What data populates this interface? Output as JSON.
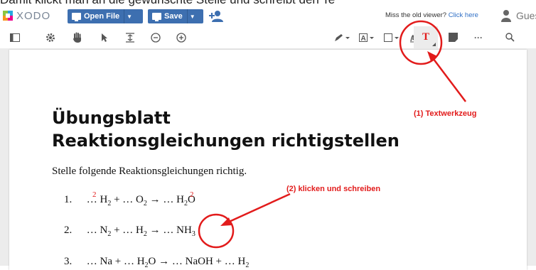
{
  "caption": "Damit klickt man an die gewünschte Stelle und schreibt den Te",
  "app": {
    "name": "XODO"
  },
  "topbar": {
    "open_file": "Open File",
    "save": "Save",
    "miss_text": "Miss the old viewer?",
    "click_here": "Click here",
    "user": "Guest"
  },
  "toolbar": {
    "icons": [
      "sidebar-icon",
      "gear-icon",
      "hand-icon",
      "pointer-icon",
      "fit-width-icon",
      "zoom-out-icon",
      "zoom-in-icon",
      "pen-icon",
      "text-style-icon",
      "shape-icon",
      "signature-icon",
      "text-tool-icon",
      "note-icon",
      "more-icon",
      "search-icon"
    ],
    "text_tool_glyph": "T",
    "more_glyph": "···"
  },
  "document": {
    "title_line1": "Übungsblatt",
    "title_line2": "Reaktionsgleichungen richtigstellen",
    "instruction": "Stelle folgende Reaktionsgleichungen richtig.",
    "equations": [
      {
        "num": "1.",
        "parts": [
          "… H",
          "2",
          " + … O",
          "2",
          " → … H",
          "2",
          "O"
        ]
      },
      {
        "num": "2.",
        "parts": [
          "… N",
          "2",
          " + … H",
          "2",
          " → … NH",
          "3",
          ""
        ]
      },
      {
        "num": "3.",
        "parts": [
          "… Na + … H",
          "2",
          "O → … NaOH + … H",
          "2",
          ""
        ]
      }
    ],
    "inserted_coeffs": [
      "2",
      "2"
    ]
  },
  "annotations": {
    "label1": "(1) Textwerkzeug",
    "label2": "(2) klicken und schreiben"
  },
  "colors": {
    "accent": "#3d6fb0",
    "annotation": "#e21b1b"
  }
}
